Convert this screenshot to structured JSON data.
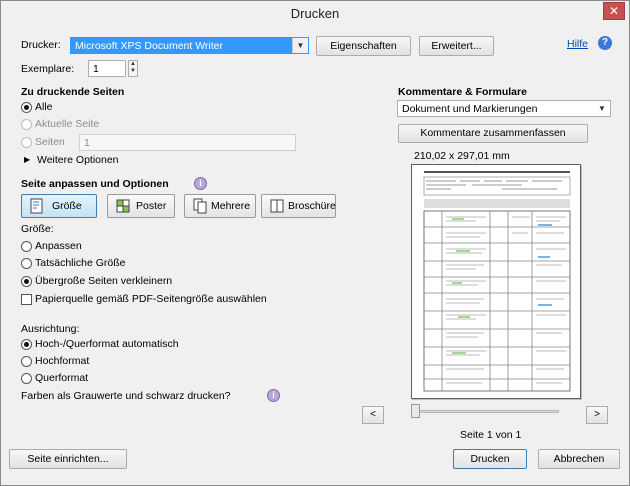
{
  "window": {
    "title": "Drucken",
    "close_glyph": "✕"
  },
  "printer": {
    "label": "Drucker:",
    "selected": "Microsoft XPS Document Writer",
    "properties_button": "Eigenschaften",
    "advanced_button": "Erweitert...",
    "help_link": "Hilfe"
  },
  "copies": {
    "label": "Exemplare:",
    "value": "1"
  },
  "pages": {
    "heading": "Zu druckende Seiten",
    "all": "Alle",
    "current": "Aktuelle Seite",
    "pages": "Seiten",
    "pages_value": "1",
    "more_options": "Weitere Optionen"
  },
  "sizing": {
    "heading": "Seite anpassen und Optionen",
    "tabs": [
      "Größe",
      "Poster",
      "Mehrere",
      "Broschüre"
    ],
    "size_label": "Größe:",
    "fit": "Anpassen",
    "actual": "Tatsächliche Größe",
    "shrink": "Übergroße Seiten verkleinern",
    "paper_source": "Papierquelle gemäß PDF-Seitengröße auswählen"
  },
  "orientation": {
    "label": "Ausrichtung:",
    "auto": "Hoch-/Querformat automatisch",
    "portrait": "Hochformat",
    "landscape": "Querformat"
  },
  "grayscale_label": "Farben als Grauwerte und schwarz drucken?",
  "comments": {
    "heading": "Kommentare & Formulare",
    "selected": "Dokument und Markierungen",
    "summarize_button": "Kommentare zusammenfassen"
  },
  "preview": {
    "size": "210,02 x 297,01 mm",
    "page_status": "Seite 1 von 1",
    "prev": "<",
    "next": ">"
  },
  "footer": {
    "page_setup_button": "Seite einrichten...",
    "print_button": "Drucken",
    "cancel_button": "Abbrechen"
  }
}
